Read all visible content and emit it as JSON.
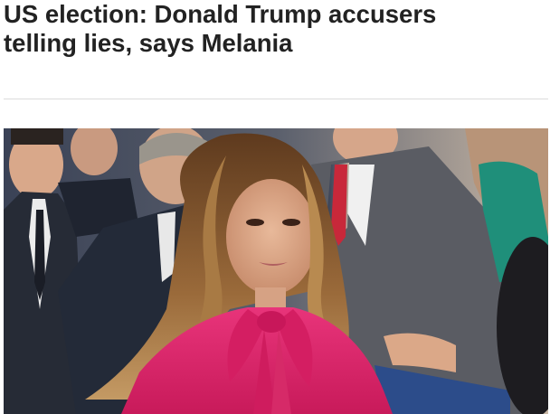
{
  "article": {
    "headline_line1": "US election: Donald Trump accusers",
    "headline_line2": "telling lies, says Melania"
  },
  "photo": {
    "subject": "photo-melania",
    "colors": {
      "blouse": "#e0246a",
      "hair": "#8a5a2e",
      "background_suits": "#2b3140",
      "teal_dress": "#1f8f7a",
      "red_tie": "#c8283a"
    }
  }
}
